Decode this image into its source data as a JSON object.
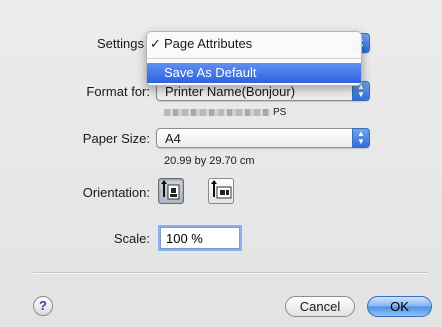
{
  "dialog": {
    "settings_label": "Settings",
    "settings_menu": {
      "items": [
        {
          "label": "Page Attributes",
          "checked": true,
          "highlighted": false
        },
        {
          "label": "Save As Default",
          "checked": false,
          "highlighted": true
        }
      ]
    },
    "format_for_label": "Format for:",
    "format_for_value": "Printer Name(Bonjour)",
    "printer_model_suffix": "PS",
    "paper_size_label": "Paper Size:",
    "paper_size_value": "A4",
    "paper_dimensions": "20.99 by 29.70 cm",
    "orientation_label": "Orientation:",
    "orientation_options": [
      {
        "name": "portrait",
        "selected": true
      },
      {
        "name": "landscape",
        "selected": false
      }
    ],
    "scale_label": "Scale:",
    "scale_value": "100 %",
    "help_glyph": "?",
    "cancel_label": "Cancel",
    "ok_label": "OK"
  },
  "colors": {
    "accent": "#2e62df",
    "dialog_bg": "#e8e8e8",
    "help_glyph": "#6a2a9a"
  },
  "icons": [
    "check-icon",
    "popup-arrows-icon",
    "portrait-icon",
    "landscape-icon",
    "help-icon"
  ]
}
